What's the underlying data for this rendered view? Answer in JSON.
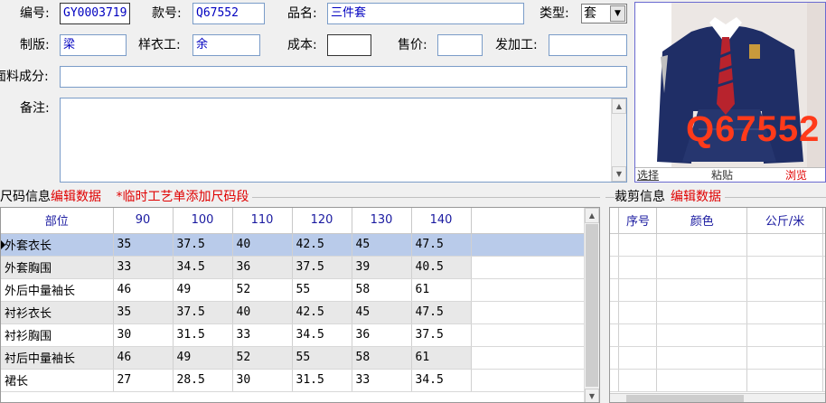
{
  "form": {
    "code_label": "编号:",
    "code_value": "GY0003719",
    "style_label": "款号:",
    "style_value": "Q67552",
    "name_label": "品名:",
    "name_value": "三件套",
    "type_label": "类型:",
    "type_value": "套",
    "maker_label": "制版:",
    "maker_value": "梁",
    "sample_label": "样衣工:",
    "sample_value": "余",
    "cost_label": "成本:",
    "cost_value": "",
    "price_label": "售价:",
    "price_value": "",
    "processor_label": "发加工:",
    "processor_value": "",
    "fabric_label": "面料成分:",
    "fabric_value": "",
    "notes_label": "备注:",
    "notes_value": ""
  },
  "photo": {
    "watermark": "Q67552",
    "select_label": "选择",
    "paste_label": "粘贴",
    "browse_label": "浏览"
  },
  "size_section": {
    "title": "尺码信息",
    "edit_link": "编辑数据",
    "note": "*临时工艺单添加尺码段",
    "headers": [
      "部位",
      "90",
      "100",
      "110",
      "120",
      "130",
      "140"
    ],
    "rows": [
      [
        "外套衣长",
        "35",
        "37.5",
        "40",
        "42.5",
        "45",
        "47.5"
      ],
      [
        "外套胸围",
        "33",
        "34.5",
        "36",
        "37.5",
        "39",
        "40.5"
      ],
      [
        "外后中量袖长",
        "46",
        "49",
        "52",
        "55",
        "58",
        "61"
      ],
      [
        "衬衫衣长",
        "35",
        "37.5",
        "40",
        "42.5",
        "45",
        "47.5"
      ],
      [
        "衬衫胸围",
        "30",
        "31.5",
        "33",
        "34.5",
        "36",
        "37.5"
      ],
      [
        "衬后中量袖长",
        "46",
        "49",
        "52",
        "55",
        "58",
        "61"
      ],
      [
        "裙长",
        "27",
        "28.5",
        "30",
        "31.5",
        "33",
        "34.5"
      ]
    ]
  },
  "cut_section": {
    "title": "裁剪信息",
    "edit_link": "编辑数据",
    "headers": [
      "序号",
      "颜色",
      "公斤/米"
    ]
  },
  "colors": {
    "accent_red": "#e00000",
    "header_blue": "#1a1aa0",
    "selected_row": "#b9cbea"
  }
}
